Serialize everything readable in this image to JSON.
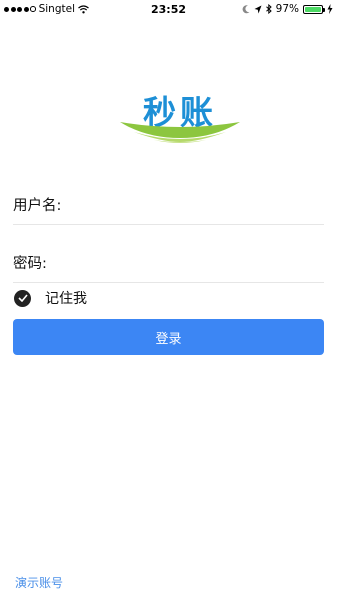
{
  "status_bar": {
    "carrier": "Singtel",
    "time": "23:52",
    "battery_percent": "97%",
    "signal_bars_filled": 4,
    "battery_level": 0.97,
    "icons": [
      "wifi-icon",
      "moon-icon",
      "location-icon",
      "bluetooth-icon",
      "charging-icon"
    ]
  },
  "logo": {
    "text": "秒账",
    "text_color": "#1d8fd6",
    "accent_color": "#8cc63f"
  },
  "form": {
    "username_label": "用户名:",
    "username_value": "",
    "password_label": "密码:",
    "password_value": "",
    "remember_label": "记住我",
    "remember_checked": true,
    "login_button": "登录"
  },
  "footer": {
    "demo_account_link": "演示账号"
  },
  "colors": {
    "primary": "#3c86f4",
    "link": "#4a8fe8",
    "battery": "#4cd964"
  }
}
